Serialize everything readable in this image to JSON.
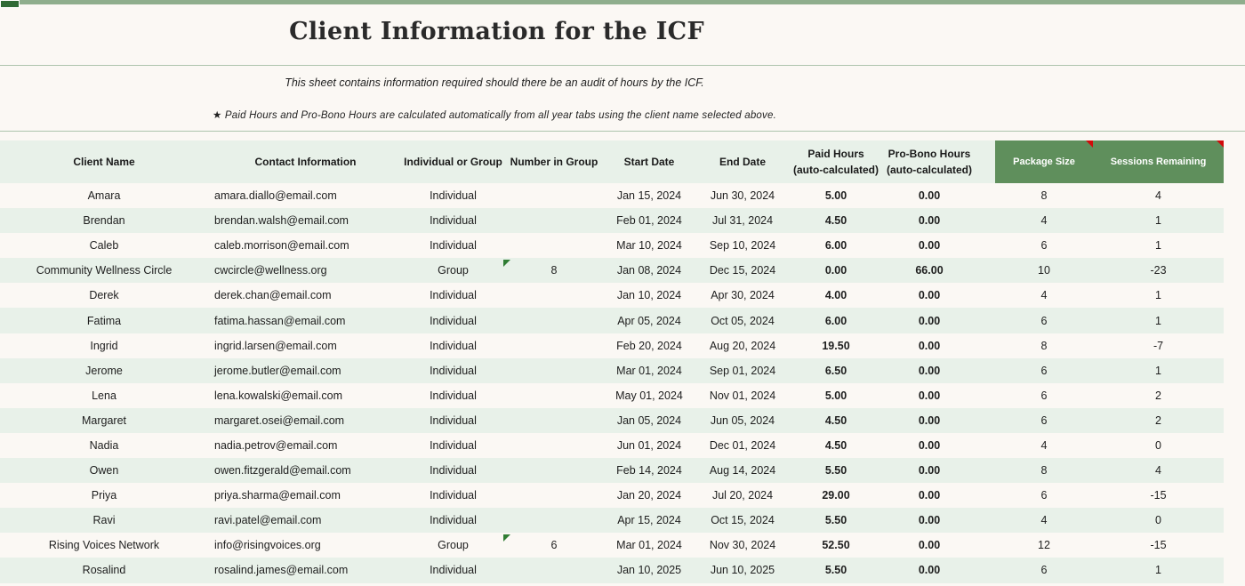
{
  "title": "Client Information for the ICF",
  "description": "This sheet contains information required should there be an audit of hours by the ICF.",
  "note": "★ Paid Hours and Pro-Bono Hours are calculated automatically from all year tabs using the client name selected above.",
  "colors": {
    "header_fill": "#e8f1e9",
    "accent_header_fill": "#5f8f5c",
    "top_bar": "#8fae8d",
    "comment_marker": "#d10a0a",
    "error_marker": "#2f7d33"
  },
  "headers": {
    "client_name": "Client Name",
    "contact_information": "Contact Information",
    "individual_or_group": "Individual or Group",
    "number_in_group": "Number in Group",
    "start_date": "Start Date",
    "end_date": "End Date",
    "paid_hours_line1": "Paid Hours",
    "paid_hours_line2": "(auto-calculated)",
    "probono_hours_line1": "Pro-Bono Hours",
    "probono_hours_line2": "(auto-calculated)",
    "package_size": "Package Size",
    "sessions_remaining": "Sessions Remaining"
  },
  "rows": [
    {
      "name": "Amara",
      "email": "amara.diallo@email.com",
      "type": "Individual",
      "group_count": "",
      "start": "Jan 15, 2024",
      "end": "Jun 30, 2024",
      "paid": "5.00",
      "probono": "0.00",
      "package": "8",
      "remaining": "4"
    },
    {
      "name": "Brendan",
      "email": "brendan.walsh@email.com",
      "type": "Individual",
      "group_count": "",
      "start": "Feb 01, 2024",
      "end": "Jul 31, 2024",
      "paid": "4.50",
      "probono": "0.00",
      "package": "4",
      "remaining": "1"
    },
    {
      "name": "Caleb",
      "email": "caleb.morrison@email.com",
      "type": "Individual",
      "group_count": "",
      "start": "Mar 10, 2024",
      "end": "Sep 10, 2024",
      "paid": "6.00",
      "probono": "0.00",
      "package": "6",
      "remaining": "1"
    },
    {
      "name": "Community Wellness Circle",
      "email": "cwcircle@wellness.org",
      "type": "Group",
      "group_count": "8",
      "start": "Jan 08, 2024",
      "end": "Dec 15, 2024",
      "paid": "0.00",
      "probono": "66.00",
      "package": "10",
      "remaining": "-23"
    },
    {
      "name": "Derek",
      "email": "derek.chan@email.com",
      "type": "Individual",
      "group_count": "",
      "start": "Jan 10, 2024",
      "end": "Apr 30, 2024",
      "paid": "4.00",
      "probono": "0.00",
      "package": "4",
      "remaining": "1"
    },
    {
      "name": "Fatima",
      "email": "fatima.hassan@email.com",
      "type": "Individual",
      "group_count": "",
      "start": "Apr 05, 2024",
      "end": "Oct 05, 2024",
      "paid": "6.00",
      "probono": "0.00",
      "package": "6",
      "remaining": "1"
    },
    {
      "name": "Ingrid",
      "email": "ingrid.larsen@email.com",
      "type": "Individual",
      "group_count": "",
      "start": "Feb 20, 2024",
      "end": "Aug 20, 2024",
      "paid": "19.50",
      "probono": "0.00",
      "package": "8",
      "remaining": "-7"
    },
    {
      "name": "Jerome",
      "email": "jerome.butler@email.com",
      "type": "Individual",
      "group_count": "",
      "start": "Mar 01, 2024",
      "end": "Sep 01, 2024",
      "paid": "6.50",
      "probono": "0.00",
      "package": "6",
      "remaining": "1"
    },
    {
      "name": "Lena",
      "email": "lena.kowalski@email.com",
      "type": "Individual",
      "group_count": "",
      "start": "May 01, 2024",
      "end": "Nov 01, 2024",
      "paid": "5.00",
      "probono": "0.00",
      "package": "6",
      "remaining": "2"
    },
    {
      "name": "Margaret",
      "email": "margaret.osei@email.com",
      "type": "Individual",
      "group_count": "",
      "start": "Jan 05, 2024",
      "end": "Jun 05, 2024",
      "paid": "4.50",
      "probono": "0.00",
      "package": "6",
      "remaining": "2"
    },
    {
      "name": "Nadia",
      "email": "nadia.petrov@email.com",
      "type": "Individual",
      "group_count": "",
      "start": "Jun 01, 2024",
      "end": "Dec 01, 2024",
      "paid": "4.50",
      "probono": "0.00",
      "package": "4",
      "remaining": "0"
    },
    {
      "name": "Owen",
      "email": "owen.fitzgerald@email.com",
      "type": "Individual",
      "group_count": "",
      "start": "Feb 14, 2024",
      "end": "Aug 14, 2024",
      "paid": "5.50",
      "probono": "0.00",
      "package": "8",
      "remaining": "4"
    },
    {
      "name": "Priya",
      "email": "priya.sharma@email.com",
      "type": "Individual",
      "group_count": "",
      "start": "Jan 20, 2024",
      "end": "Jul 20, 2024",
      "paid": "29.00",
      "probono": "0.00",
      "package": "6",
      "remaining": "-15"
    },
    {
      "name": "Ravi",
      "email": "ravi.patel@email.com",
      "type": "Individual",
      "group_count": "",
      "start": "Apr 15, 2024",
      "end": "Oct 15, 2024",
      "paid": "5.50",
      "probono": "0.00",
      "package": "4",
      "remaining": "0"
    },
    {
      "name": "Rising Voices Network",
      "email": "info@risingvoices.org",
      "type": "Group",
      "group_count": "6",
      "start": "Mar 01, 2024",
      "end": "Nov 30, 2024",
      "paid": "52.50",
      "probono": "0.00",
      "package": "12",
      "remaining": "-15"
    },
    {
      "name": "Rosalind",
      "email": "rosalind.james@email.com",
      "type": "Individual",
      "group_count": "",
      "start": "Jan 10, 2025",
      "end": "Jun 10, 2025",
      "paid": "5.50",
      "probono": "0.00",
      "package": "6",
      "remaining": "1"
    }
  ]
}
